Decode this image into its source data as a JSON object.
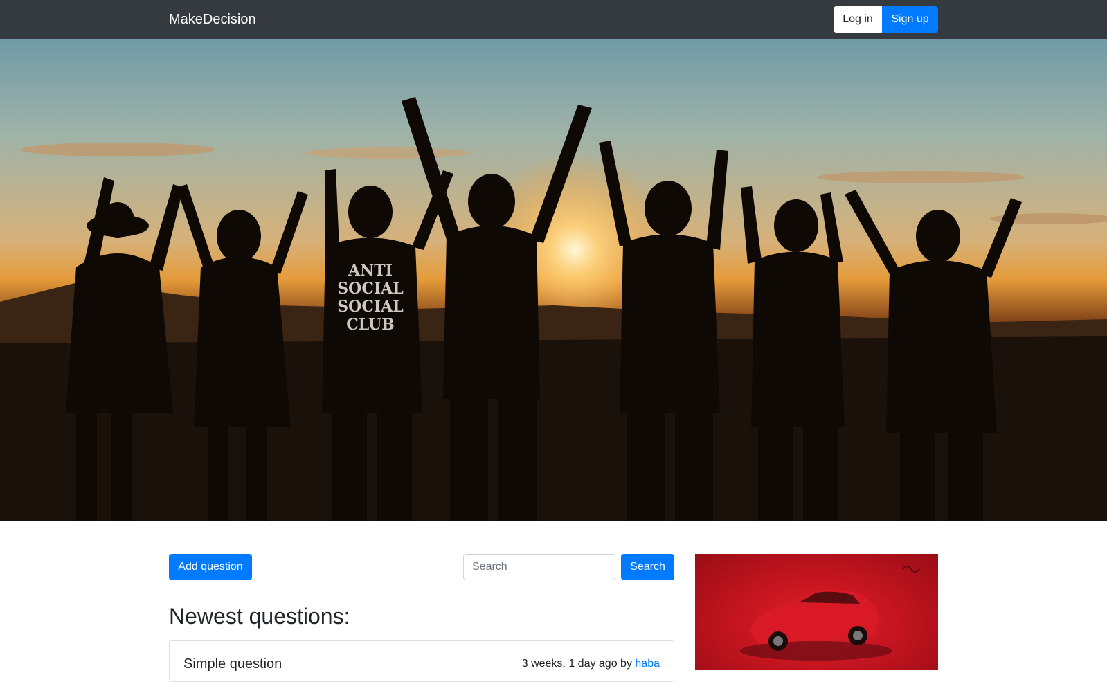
{
  "navbar": {
    "brand": "MakeDecision",
    "login_label": "Log in",
    "signup_label": "Sign up"
  },
  "hero": {
    "image": "silhouettes-raising-hands-at-sunset",
    "shirt_text": [
      "ANTI",
      "SOCIAL",
      "SOCIAL",
      "CLUB"
    ]
  },
  "toolbar": {
    "add_question_label": "Add question",
    "search_placeholder": "Search",
    "search_value": "",
    "search_button_label": "Search"
  },
  "main": {
    "section_title": "Newest questions:",
    "questions": [
      {
        "title": "Simple question",
        "time": "3 weeks, 1 day ago by",
        "author": "haba"
      }
    ]
  },
  "sidebar_ad": {
    "image": "red-sedan-car-advertisement"
  },
  "colors": {
    "navbar_bg": "#343a40",
    "primary": "#007bff",
    "ad_bg": "#c51520"
  }
}
